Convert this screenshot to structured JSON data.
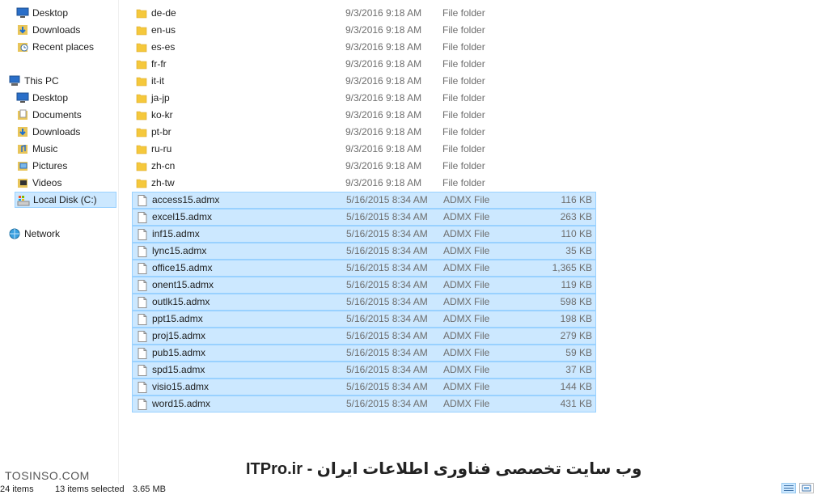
{
  "nav": {
    "quick_access": [
      {
        "label": "Desktop",
        "icon": "desktop-icon"
      },
      {
        "label": "Downloads",
        "icon": "downloads-icon"
      },
      {
        "label": "Recent places",
        "icon": "recent-places-icon"
      }
    ],
    "this_pc": "This PC",
    "this_pc_items": [
      {
        "label": "Desktop",
        "icon": "desktop-icon"
      },
      {
        "label": "Documents",
        "icon": "documents-icon"
      },
      {
        "label": "Downloads",
        "icon": "downloads-icon"
      },
      {
        "label": "Music",
        "icon": "music-icon"
      },
      {
        "label": "Pictures",
        "icon": "pictures-icon"
      },
      {
        "label": "Videos",
        "icon": "videos-icon"
      },
      {
        "label": "Local Disk (C:)",
        "icon": "local-disk-icon"
      }
    ],
    "network": "Network"
  },
  "files": [
    {
      "name": "de-de",
      "date": "9/3/2016 9:18 AM",
      "type": "File folder",
      "size": "",
      "kind": "folder",
      "selected": false
    },
    {
      "name": "en-us",
      "date": "9/3/2016 9:18 AM",
      "type": "File folder",
      "size": "",
      "kind": "folder",
      "selected": false
    },
    {
      "name": "es-es",
      "date": "9/3/2016 9:18 AM",
      "type": "File folder",
      "size": "",
      "kind": "folder",
      "selected": false
    },
    {
      "name": "fr-fr",
      "date": "9/3/2016 9:18 AM",
      "type": "File folder",
      "size": "",
      "kind": "folder",
      "selected": false
    },
    {
      "name": "it-it",
      "date": "9/3/2016 9:18 AM",
      "type": "File folder",
      "size": "",
      "kind": "folder",
      "selected": false
    },
    {
      "name": "ja-jp",
      "date": "9/3/2016 9:18 AM",
      "type": "File folder",
      "size": "",
      "kind": "folder",
      "selected": false
    },
    {
      "name": "ko-kr",
      "date": "9/3/2016 9:18 AM",
      "type": "File folder",
      "size": "",
      "kind": "folder",
      "selected": false
    },
    {
      "name": "pt-br",
      "date": "9/3/2016 9:18 AM",
      "type": "File folder",
      "size": "",
      "kind": "folder",
      "selected": false
    },
    {
      "name": "ru-ru",
      "date": "9/3/2016 9:18 AM",
      "type": "File folder",
      "size": "",
      "kind": "folder",
      "selected": false
    },
    {
      "name": "zh-cn",
      "date": "9/3/2016 9:18 AM",
      "type": "File folder",
      "size": "",
      "kind": "folder",
      "selected": false
    },
    {
      "name": "zh-tw",
      "date": "9/3/2016 9:18 AM",
      "type": "File folder",
      "size": "",
      "kind": "folder",
      "selected": false
    },
    {
      "name": "access15.admx",
      "date": "5/16/2015 8:34 AM",
      "type": "ADMX File",
      "size": "116 KB",
      "kind": "file",
      "selected": true
    },
    {
      "name": "excel15.admx",
      "date": "5/16/2015 8:34 AM",
      "type": "ADMX File",
      "size": "263 KB",
      "kind": "file",
      "selected": true
    },
    {
      "name": "inf15.admx",
      "date": "5/16/2015 8:34 AM",
      "type": "ADMX File",
      "size": "110 KB",
      "kind": "file",
      "selected": true
    },
    {
      "name": "lync15.admx",
      "date": "5/16/2015 8:34 AM",
      "type": "ADMX File",
      "size": "35 KB",
      "kind": "file",
      "selected": true
    },
    {
      "name": "office15.admx",
      "date": "5/16/2015 8:34 AM",
      "type": "ADMX File",
      "size": "1,365 KB",
      "kind": "file",
      "selected": true
    },
    {
      "name": "onent15.admx",
      "date": "5/16/2015 8:34 AM",
      "type": "ADMX File",
      "size": "119 KB",
      "kind": "file",
      "selected": true
    },
    {
      "name": "outlk15.admx",
      "date": "5/16/2015 8:34 AM",
      "type": "ADMX File",
      "size": "598 KB",
      "kind": "file",
      "selected": true
    },
    {
      "name": "ppt15.admx",
      "date": "5/16/2015 8:34 AM",
      "type": "ADMX File",
      "size": "198 KB",
      "kind": "file",
      "selected": true
    },
    {
      "name": "proj15.admx",
      "date": "5/16/2015 8:34 AM",
      "type": "ADMX File",
      "size": "279 KB",
      "kind": "file",
      "selected": true
    },
    {
      "name": "pub15.admx",
      "date": "5/16/2015 8:34 AM",
      "type": "ADMX File",
      "size": "59 KB",
      "kind": "file",
      "selected": true
    },
    {
      "name": "spd15.admx",
      "date": "5/16/2015 8:34 AM",
      "type": "ADMX File",
      "size": "37 KB",
      "kind": "file",
      "selected": true
    },
    {
      "name": "visio15.admx",
      "date": "5/16/2015 8:34 AM",
      "type": "ADMX File",
      "size": "144 KB",
      "kind": "file",
      "selected": true
    },
    {
      "name": "word15.admx",
      "date": "5/16/2015 8:34 AM",
      "type": "ADMX File",
      "size": "431 KB",
      "kind": "file",
      "selected": true
    }
  ],
  "status": {
    "item_count": "24 items",
    "selection": "13 items selected",
    "selection_size": "3.65 MB"
  },
  "watermark": {
    "left": "TOSINSO.COM",
    "center": "ITPro.ir - وب سایت تخصصی فناوری اطلاعات ایران"
  },
  "colors": {
    "selection_fill": "#cce8ff",
    "selection_border": "#99d1ff",
    "folder": "#f5c83c"
  }
}
